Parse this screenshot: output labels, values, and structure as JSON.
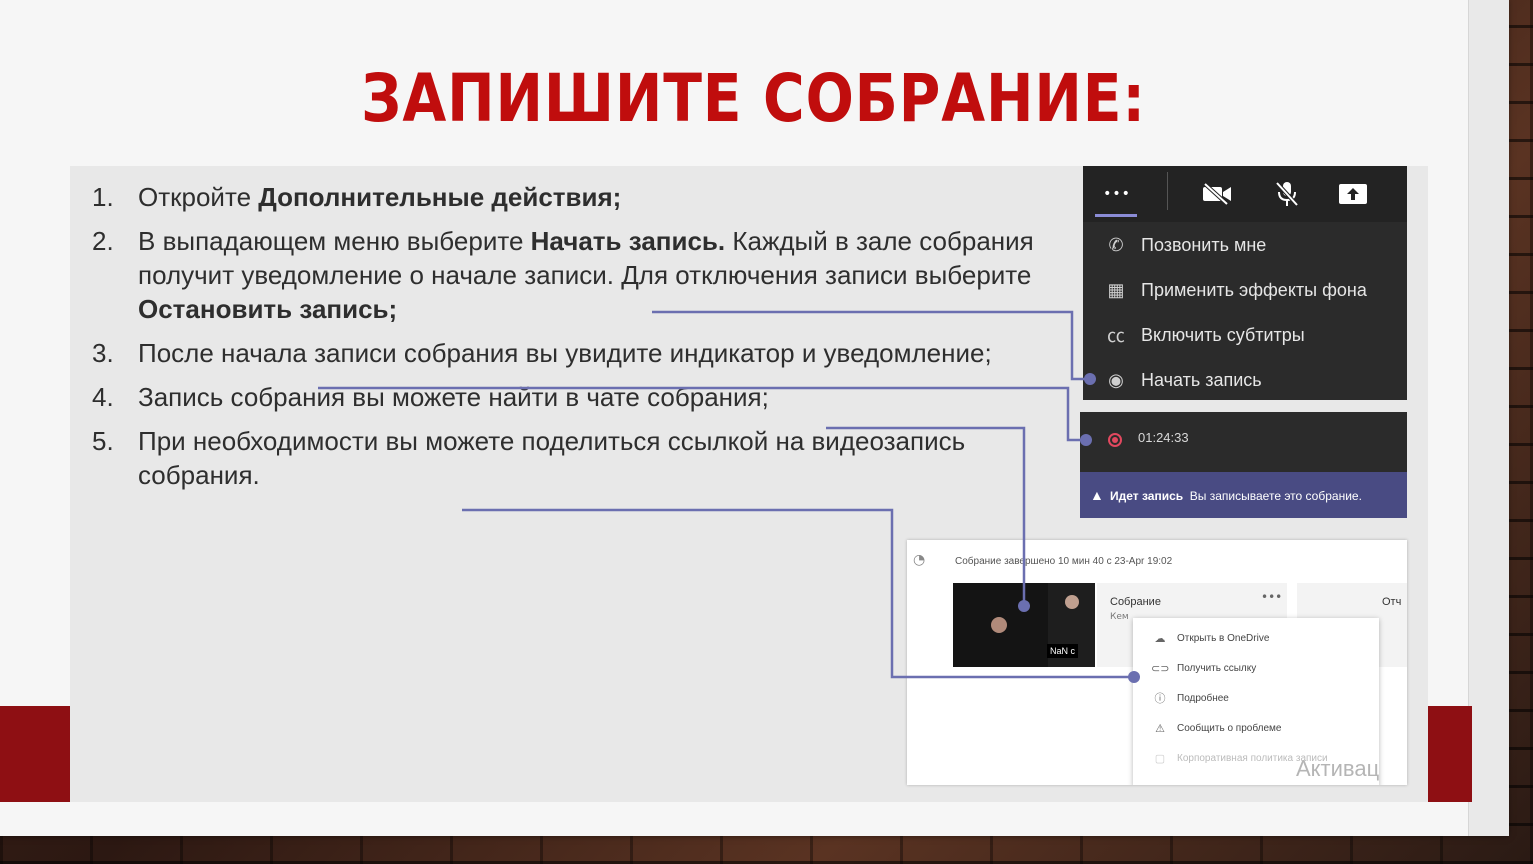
{
  "slide": {
    "title": "ЗАПИШИТЕ СОБРАНИЕ:"
  },
  "steps": [
    {
      "num": "1.",
      "text": "Откройте ",
      "bold": "Дополнительные действия;",
      "after": ""
    },
    {
      "num": "2.",
      "text": "В выпадающем меню выберите ",
      "bold": "Начать запись.",
      "after": " Каждый в зале собрания получит уведомление о начале записи. Для отключения записи выберите ",
      "bold2": "Остановить запись;"
    },
    {
      "num": "3.",
      "text": "После начала записи собрания вы увидите индикатор и уведомление;"
    },
    {
      "num": "4.",
      "text": "Запись собрания вы можете найти в чате собрания;"
    },
    {
      "num": "5.",
      "text": "При необходимости вы можете поделиться ссылкой на видеозапись собрания."
    }
  ],
  "menu": {
    "more_label": "•••",
    "items": [
      {
        "label": "Позвонить мне",
        "icon": "phone-icon",
        "glyph": "✆"
      },
      {
        "label": "Применить эффекты фона",
        "icon": "background-effects-icon",
        "glyph": "▦"
      },
      {
        "label": "Включить субтитры",
        "icon": "captions-icon",
        "glyph": "㏄"
      },
      {
        "label": "Начать запись",
        "icon": "record-icon",
        "glyph": "◉"
      }
    ]
  },
  "recording": {
    "time": "01:24:33",
    "notice_bold": "Идет запись",
    "notice_text": "Вы записываете это собрание."
  },
  "chat": {
    "header": "Собрание завершено  10 мин 40 с    23-Apr 19:02",
    "card_title": "Собрание",
    "card_sub": "Кем",
    "card2_title": "Отч",
    "thumb_label": "NaN с",
    "context_menu": [
      {
        "label": "Открыть в OneDrive",
        "icon": "onedrive-icon",
        "glyph": "☁"
      },
      {
        "label": "Получить ссылку",
        "icon": "link-icon",
        "glyph": "⊂⊃"
      },
      {
        "label": "Подробнее",
        "icon": "info-icon",
        "glyph": "ⓘ"
      },
      {
        "label": "Сообщить о проблеме",
        "icon": "warning-icon",
        "glyph": "⚠"
      },
      {
        "label": "Корпоративная политика записи",
        "icon": "policy-icon",
        "glyph": "▢"
      }
    ]
  },
  "watermark": "Активац",
  "colors": {
    "title": "#c00d0d",
    "band": "#8e0f13",
    "connector": "#6b6fb0",
    "notice": "#494b83"
  }
}
